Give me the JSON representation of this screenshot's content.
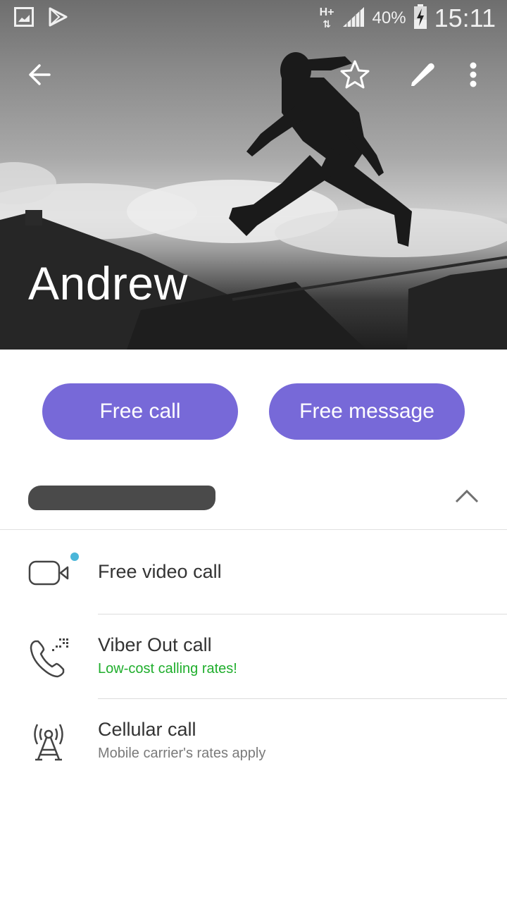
{
  "status_bar": {
    "network_type": "H+",
    "battery_percent": "40%",
    "time": "15:11",
    "left_icons": [
      "gallery-notification-icon",
      "play-store-notification-icon"
    ],
    "right_icons": [
      "hplus-data-icon",
      "signal-icon",
      "battery-charging-icon"
    ]
  },
  "toolbar": {
    "back_icon": "arrow-left",
    "actions": [
      "star-icon",
      "pencil-icon",
      "more-vertical-icon"
    ]
  },
  "contact": {
    "name": "Andrew",
    "number_redacted": true
  },
  "actions": {
    "free_call_label": "Free call",
    "free_message_label": "Free message"
  },
  "options": [
    {
      "title": "Free video call",
      "subtitle": "",
      "icon": "video-camera-icon",
      "has_new_badge": true
    },
    {
      "title": "Viber Out call",
      "subtitle": "Low-cost calling rates!",
      "icon": "viber-out-phone-icon",
      "subtitle_color": "#1fae2c"
    },
    {
      "title": "Cellular call",
      "subtitle": "Mobile carrier's rates apply",
      "icon": "cell-tower-icon",
      "subtitle_color": "#7a7a7a"
    }
  ],
  "colors": {
    "accent": "#7769d8",
    "badge": "#4ab6d9",
    "viber_out_green": "#1fae2c"
  }
}
